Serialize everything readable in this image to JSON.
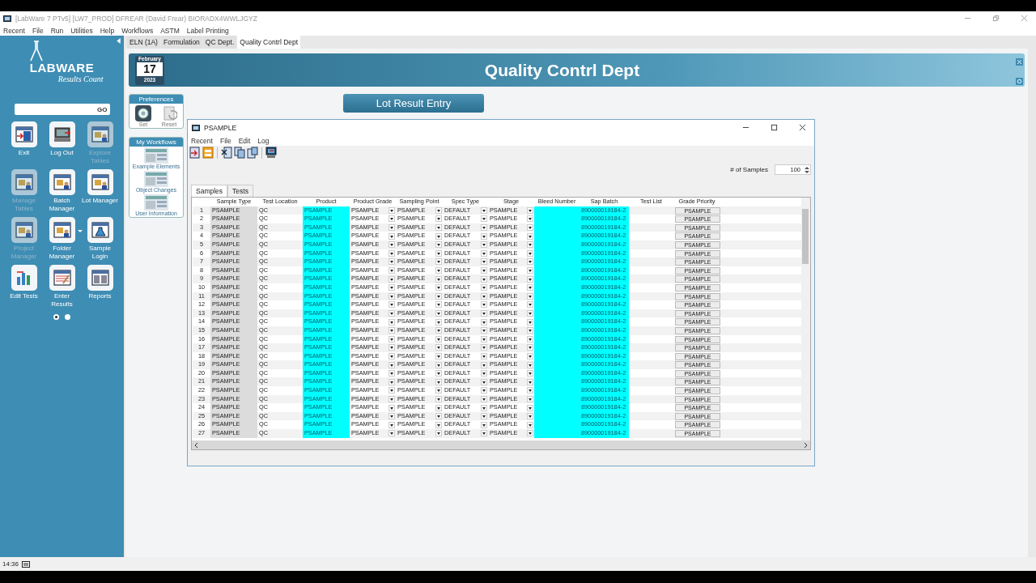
{
  "window": {
    "title": "[LabWare 7 PTv5] [LW7_PROD] DFREAR (David Frear) BIORADX4WWLJGYZ"
  },
  "menu": [
    "Recent",
    "File",
    "Run",
    "Utilities",
    "Help",
    "Workflows",
    "ASTM",
    "Label Printing"
  ],
  "sidebar": {
    "logo_title": "LABWARE",
    "logo_subtitle": "Results Count",
    "search_button": "GO",
    "launchers": [
      {
        "label": "Exit",
        "disabled": false,
        "dropdown": false
      },
      {
        "label": "Log Out",
        "disabled": false,
        "dropdown": false
      },
      {
        "label": "Explore Tables",
        "disabled": true,
        "dropdown": false
      },
      {
        "label": "Manage Tables",
        "disabled": true,
        "dropdown": false
      },
      {
        "label": "Batch Manager",
        "disabled": false,
        "dropdown": false
      },
      {
        "label": "Lot Manager",
        "disabled": false,
        "dropdown": false
      },
      {
        "label": "Project Manager",
        "disabled": true,
        "dropdown": false
      },
      {
        "label": "Folder Manager",
        "disabled": false,
        "dropdown": true
      },
      {
        "label": "Sample Login",
        "disabled": false,
        "dropdown": false
      },
      {
        "label": "Edit Tests",
        "disabled": false,
        "dropdown": false
      },
      {
        "label": "Enter Results",
        "disabled": false,
        "dropdown": false
      },
      {
        "label": "Reports",
        "disabled": false,
        "dropdown": false
      }
    ],
    "pages": [
      {
        "selected": true
      },
      {
        "selected": false
      }
    ]
  },
  "tabs": [
    {
      "label": "ELN (1A)",
      "selected": false
    },
    {
      "label": "Formulation",
      "selected": false
    },
    {
      "label": "QC Dept.",
      "selected": false
    },
    {
      "label": "Quality Contrl Dept",
      "selected": true
    }
  ],
  "header": {
    "month": "February",
    "day": "17",
    "year": "2023",
    "title": "Quality Contrl Dept"
  },
  "preferences": {
    "title": "Preferences",
    "buttons": [
      "Set",
      "Reset"
    ]
  },
  "workflows": {
    "title": "My Workflows",
    "items": [
      "Example Elements",
      "Object Changes",
      "User Information"
    ]
  },
  "lot_button": "Lot Result Entry",
  "dialog": {
    "title": "PSAMPLE",
    "menu": [
      "Recent",
      "File",
      "Edit",
      "Log"
    ],
    "samples_label": "# of Samples",
    "samples_value": "100",
    "tabs": [
      {
        "label": "Samples",
        "selected": true
      },
      {
        "label": "Tests",
        "selected": false
      }
    ],
    "columns": [
      {
        "label": "Sample Type",
        "kind": "shaded"
      },
      {
        "label": "Test Location",
        "kind": "text"
      },
      {
        "label": "Product",
        "kind": "cyan"
      },
      {
        "label": "Product Grade",
        "kind": "dropdown"
      },
      {
        "label": "Sampling Point",
        "kind": "dropdown"
      },
      {
        "label": "Spec Type",
        "kind": "dropdown"
      },
      {
        "label": "Stage",
        "kind": "dropdown"
      },
      {
        "label": "Bleed Number",
        "kind": "cyan"
      },
      {
        "label": "Sap Batch",
        "kind": "cyan"
      },
      {
        "label": "Test List",
        "kind": "text"
      },
      {
        "label": "Grade Priority",
        "kind": "button"
      }
    ],
    "rows": [
      {
        "no": "1",
        "cells": [
          "PSAMPLE",
          "QC",
          "PSAMPLE",
          "PSAMPLE",
          "PSAMPLE",
          "DEFAULT",
          "PSAMPLE",
          null,
          "890000019184-2",
          null,
          "PSAMPLE"
        ]
      },
      {
        "no": "2",
        "cells": [
          "PSAMPLE",
          "QC",
          "PSAMPLE",
          "PSAMPLE",
          "PSAMPLE",
          "DEFAULT",
          "PSAMPLE",
          null,
          "890000019184-2",
          null,
          "PSAMPLE"
        ]
      },
      {
        "no": "3",
        "cells": [
          "PSAMPLE",
          "QC",
          "PSAMPLE",
          "PSAMPLE",
          "PSAMPLE",
          "DEFAULT",
          "PSAMPLE",
          null,
          "890000019184-2",
          null,
          "PSAMPLE"
        ]
      },
      {
        "no": "4",
        "cells": [
          "PSAMPLE",
          "QC",
          "PSAMPLE",
          "PSAMPLE",
          "PSAMPLE",
          "DEFAULT",
          "PSAMPLE",
          null,
          "890000019184-2",
          null,
          "PSAMPLE"
        ]
      },
      {
        "no": "5",
        "cells": [
          "PSAMPLE",
          "QC",
          "PSAMPLE",
          "PSAMPLE",
          "PSAMPLE",
          "DEFAULT",
          "PSAMPLE",
          null,
          "890000019184-2",
          null,
          "PSAMPLE"
        ]
      },
      {
        "no": "6",
        "cells": [
          "PSAMPLE",
          "QC",
          "PSAMPLE",
          "PSAMPLE",
          "PSAMPLE",
          "DEFAULT",
          "PSAMPLE",
          null,
          "890000019184-2",
          null,
          "PSAMPLE"
        ]
      },
      {
        "no": "7",
        "cells": [
          "PSAMPLE",
          "QC",
          "PSAMPLE",
          "PSAMPLE",
          "PSAMPLE",
          "DEFAULT",
          "PSAMPLE",
          null,
          "890000019184-2",
          null,
          "PSAMPLE"
        ]
      },
      {
        "no": "8",
        "cells": [
          "PSAMPLE",
          "QC",
          "PSAMPLE",
          "PSAMPLE",
          "PSAMPLE",
          "DEFAULT",
          "PSAMPLE",
          null,
          "890000019184-2",
          null,
          "PSAMPLE"
        ]
      },
      {
        "no": "9",
        "cells": [
          "PSAMPLE",
          "QC",
          "PSAMPLE",
          "PSAMPLE",
          "PSAMPLE",
          "DEFAULT",
          "PSAMPLE",
          null,
          "890000019184-2",
          null,
          "PSAMPLE"
        ]
      },
      {
        "no": "10",
        "cells": [
          "PSAMPLE",
          "QC",
          "PSAMPLE",
          "PSAMPLE",
          "PSAMPLE",
          "DEFAULT",
          "PSAMPLE",
          null,
          "890000019184-2",
          null,
          "PSAMPLE"
        ]
      },
      {
        "no": "11",
        "cells": [
          "PSAMPLE",
          "QC",
          "PSAMPLE",
          "PSAMPLE",
          "PSAMPLE",
          "DEFAULT",
          "PSAMPLE",
          null,
          "890000019184-2",
          null,
          "PSAMPLE"
        ]
      },
      {
        "no": "12",
        "cells": [
          "PSAMPLE",
          "QC",
          "PSAMPLE",
          "PSAMPLE",
          "PSAMPLE",
          "DEFAULT",
          "PSAMPLE",
          null,
          "890000019184-2",
          null,
          "PSAMPLE"
        ]
      },
      {
        "no": "13",
        "cells": [
          "PSAMPLE",
          "QC",
          "PSAMPLE",
          "PSAMPLE",
          "PSAMPLE",
          "DEFAULT",
          "PSAMPLE",
          null,
          "890000019184-2",
          null,
          "PSAMPLE"
        ]
      },
      {
        "no": "14",
        "cells": [
          "PSAMPLE",
          "QC",
          "PSAMPLE",
          "PSAMPLE",
          "PSAMPLE",
          "DEFAULT",
          "PSAMPLE",
          null,
          "890000019184-2",
          null,
          "PSAMPLE"
        ]
      },
      {
        "no": "15",
        "cells": [
          "PSAMPLE",
          "QC",
          "PSAMPLE",
          "PSAMPLE",
          "PSAMPLE",
          "DEFAULT",
          "PSAMPLE",
          null,
          "890000019184-2",
          null,
          "PSAMPLE"
        ]
      },
      {
        "no": "16",
        "cells": [
          "PSAMPLE",
          "QC",
          "PSAMPLE",
          "PSAMPLE",
          "PSAMPLE",
          "DEFAULT",
          "PSAMPLE",
          null,
          "890000019184-2",
          null,
          "PSAMPLE"
        ]
      },
      {
        "no": "17",
        "cells": [
          "PSAMPLE",
          "QC",
          "PSAMPLE",
          "PSAMPLE",
          "PSAMPLE",
          "DEFAULT",
          "PSAMPLE",
          null,
          "890000019184-2",
          null,
          "PSAMPLE"
        ]
      },
      {
        "no": "18",
        "cells": [
          "PSAMPLE",
          "QC",
          "PSAMPLE",
          "PSAMPLE",
          "PSAMPLE",
          "DEFAULT",
          "PSAMPLE",
          null,
          "890000019184-2",
          null,
          "PSAMPLE"
        ]
      },
      {
        "no": "19",
        "cells": [
          "PSAMPLE",
          "QC",
          "PSAMPLE",
          "PSAMPLE",
          "PSAMPLE",
          "DEFAULT",
          "PSAMPLE",
          null,
          "890000019184-2",
          null,
          "PSAMPLE"
        ]
      },
      {
        "no": "20",
        "cells": [
          "PSAMPLE",
          "QC",
          "PSAMPLE",
          "PSAMPLE",
          "PSAMPLE",
          "DEFAULT",
          "PSAMPLE",
          null,
          "890000019184-2",
          null,
          "PSAMPLE"
        ]
      },
      {
        "no": "21",
        "cells": [
          "PSAMPLE",
          "QC",
          "PSAMPLE",
          "PSAMPLE",
          "PSAMPLE",
          "DEFAULT",
          "PSAMPLE",
          null,
          "890000019184-2",
          null,
          "PSAMPLE"
        ]
      },
      {
        "no": "22",
        "cells": [
          "PSAMPLE",
          "QC",
          "PSAMPLE",
          "PSAMPLE",
          "PSAMPLE",
          "DEFAULT",
          "PSAMPLE",
          null,
          "890000019184-2",
          null,
          "PSAMPLE"
        ]
      },
      {
        "no": "23",
        "cells": [
          "PSAMPLE",
          "QC",
          "PSAMPLE",
          "PSAMPLE",
          "PSAMPLE",
          "DEFAULT",
          "PSAMPLE",
          null,
          "890000019184-2",
          null,
          "PSAMPLE"
        ]
      },
      {
        "no": "24",
        "cells": [
          "PSAMPLE",
          "QC",
          "PSAMPLE",
          "PSAMPLE",
          "PSAMPLE",
          "DEFAULT",
          "PSAMPLE",
          null,
          "890000019184-2",
          null,
          "PSAMPLE"
        ]
      },
      {
        "no": "25",
        "cells": [
          "PSAMPLE",
          "QC",
          "PSAMPLE",
          "PSAMPLE",
          "PSAMPLE",
          "DEFAULT",
          "PSAMPLE",
          null,
          "890000019184-2",
          null,
          "PSAMPLE"
        ]
      },
      {
        "no": "26",
        "cells": [
          "PSAMPLE",
          "QC",
          "PSAMPLE",
          "PSAMPLE",
          "PSAMPLE",
          "DEFAULT",
          "PSAMPLE",
          null,
          "890000019184-2",
          null,
          "PSAMPLE"
        ]
      },
      {
        "no": "27",
        "cells": [
          "PSAMPLE",
          "QC",
          "PSAMPLE",
          "PSAMPLE",
          "PSAMPLE",
          "DEFAULT",
          "PSAMPLE",
          null,
          "890000019184-2",
          null,
          "PSAMPLE"
        ]
      }
    ]
  },
  "status_bar": {
    "time": "14:36"
  }
}
